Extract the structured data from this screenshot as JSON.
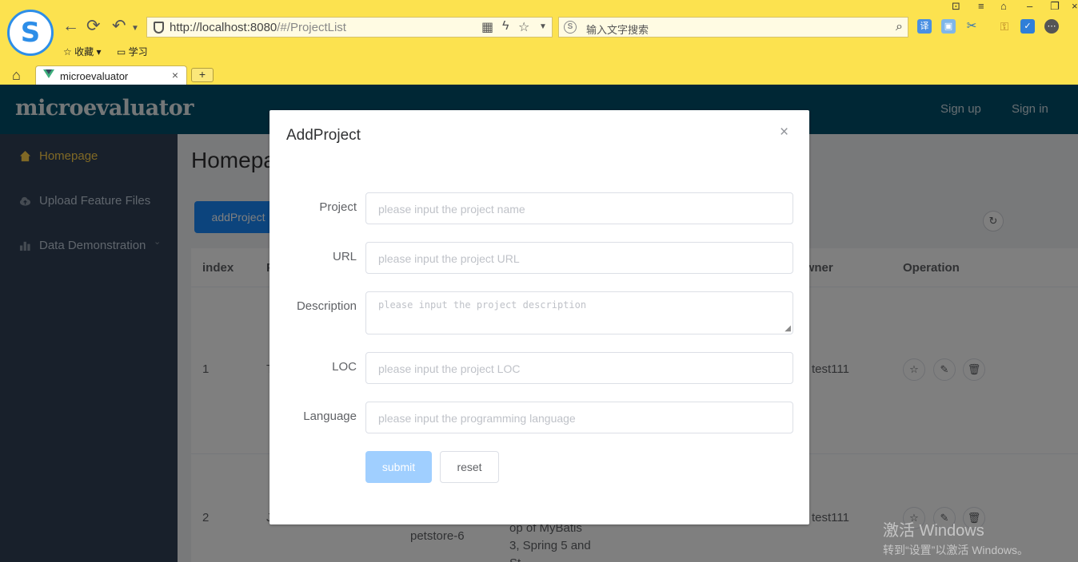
{
  "browser": {
    "url_host": "http://localhost:8080",
    "url_path": "/#/ProjectList",
    "search_placeholder": "输入文字搜索",
    "bookmarks": [
      "收藏",
      "学习"
    ],
    "tab_title": "microevaluator",
    "new_tab_label": "+",
    "tab_close_label": "×"
  },
  "app": {
    "title": "microevaluator",
    "header_links": [
      "Sign up",
      "Sign in"
    ],
    "sidebar": {
      "items": [
        {
          "label": "Homepage",
          "icon": "home-icon",
          "active": true
        },
        {
          "label": "Upload Feature Files",
          "icon": "cloud-upload-icon",
          "active": false
        },
        {
          "label": "Data Demonstration",
          "icon": "bar-chart-icon",
          "active": false
        }
      ]
    },
    "page_title": "Homepage",
    "add_button": "addProject",
    "table": {
      "columns": [
        "index",
        "P",
        "Owner",
        "Operation"
      ],
      "rows": [
        {
          "index": "1",
          "name": "T",
          "owner": "test111"
        },
        {
          "index": "2",
          "name": "J",
          "project_suffix": "petstore-6",
          "desc_lines": [
            "op of MyBatis",
            "3, Spring 5 and",
            "St"
          ],
          "owner": "test111"
        }
      ]
    }
  },
  "modal": {
    "title": "AddProject",
    "close_label": "×",
    "fields": [
      {
        "label": "Project",
        "placeholder": "please input the project name"
      },
      {
        "label": "URL",
        "placeholder": "please input the project URL"
      },
      {
        "label": "Description",
        "placeholder": "please input the project description"
      },
      {
        "label": "LOC",
        "placeholder": "please input the project LOC"
      },
      {
        "label": "Language",
        "placeholder": "please input the programming language"
      }
    ],
    "submit_label": "submit",
    "reset_label": "reset"
  },
  "watermark": {
    "line1": "激活 Windows",
    "line2": "转到“设置”以激活 Windows。"
  },
  "colors": {
    "browser_bar": "#fce24f",
    "header": "#004f6b",
    "sidebar": "#304156",
    "active_menu": "#ffd04b",
    "primary": "#1989fa",
    "submit_disabled": "#a0cfff"
  }
}
